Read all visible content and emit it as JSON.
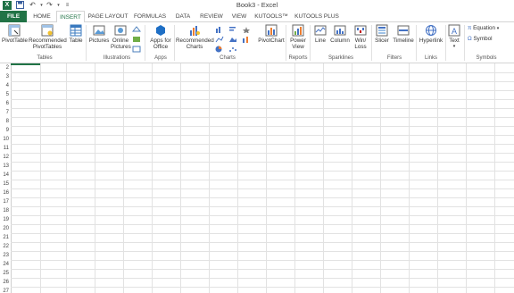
{
  "window": {
    "title": "Book3 - Excel"
  },
  "qat": {
    "app_icon": "X"
  },
  "tabs": [
    "FILE",
    "HOME",
    "INSERT",
    "PAGE LAYOUT",
    "FORMULAS",
    "DATA",
    "REVIEW",
    "VIEW",
    "KUTOOLS™",
    "KUTOOLS PLUS"
  ],
  "ribbon": {
    "tables": {
      "pivot": "PivotTable",
      "rec_pivot_1": "Recommended",
      "rec_pivot_2": "PivotTables",
      "table": "Table",
      "group": "Tables"
    },
    "illustrations": {
      "pictures": "Pictures",
      "online_1": "Online",
      "online_2": "Pictures",
      "group": "Illustrations"
    },
    "apps": {
      "apps_1": "Apps for",
      "apps_2": "Office",
      "group": "Apps"
    },
    "charts": {
      "rec_1": "Recommended",
      "rec_2": "Charts",
      "pivotchart": "PivotChart",
      "group": "Charts"
    },
    "reports": {
      "power_1": "Power",
      "power_2": "View",
      "group": "Reports"
    },
    "sparklines": {
      "line": "Line",
      "column": "Column",
      "winloss_1": "Win/",
      "winloss_2": "Loss",
      "group": "Sparklines"
    },
    "filters": {
      "slicer": "Slicer",
      "timeline": "Timeline",
      "group": "Filters"
    },
    "links": {
      "hyperlink": "Hyperlink",
      "group": "Links"
    },
    "text": {
      "text": "Text"
    },
    "symbols": {
      "equation": "Equation",
      "symbol": "Symbol",
      "group": "Symbols"
    }
  },
  "rows": [
    "2",
    "3",
    "4",
    "5",
    "6",
    "7",
    "8",
    "9",
    "10",
    "11",
    "12",
    "13",
    "14",
    "15",
    "16",
    "17",
    "18",
    "19",
    "20",
    "21",
    "22",
    "23",
    "24",
    "25",
    "26",
    "27"
  ]
}
